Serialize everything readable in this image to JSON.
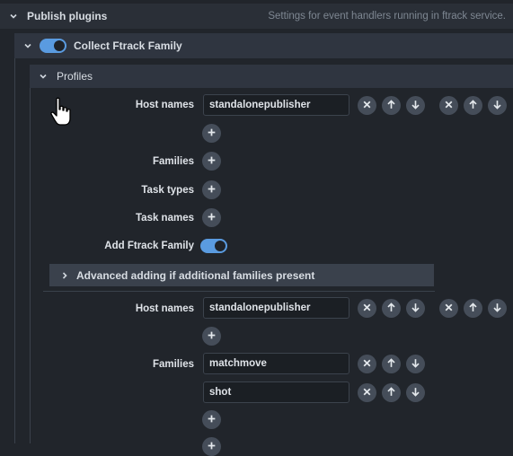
{
  "publish": {
    "title": "Publish plugins",
    "description": "Settings for event handlers running in ftrack service."
  },
  "collect": {
    "title": "Collect Ftrack Family",
    "enabled": true
  },
  "profiles": {
    "title": "Profiles",
    "labels": {
      "host_names": "Host names",
      "families": "Families",
      "task_types": "Task types",
      "task_names": "Task names",
      "add_family": "Add Ftrack Family"
    },
    "profile1": {
      "host_names": [
        "standalonepublisher"
      ],
      "add_family": true
    },
    "advanced": {
      "title": "Advanced adding if additional families present"
    },
    "profile2": {
      "host_names": [
        "standalonepublisher"
      ],
      "families": [
        "matchmove",
        "shot"
      ]
    }
  },
  "icons": {
    "remove": "close-icon",
    "move_up": "arrow-up-icon",
    "move_down": "arrow-down-icon",
    "add": "plus-icon",
    "expand": "chevron-down-icon",
    "collapsed": "chevron-right-icon",
    "cursor": "hand-pointer-icon"
  },
  "colors": {
    "background": "#21252b",
    "bar": "#2f3540",
    "accent": "#5a9be0"
  }
}
